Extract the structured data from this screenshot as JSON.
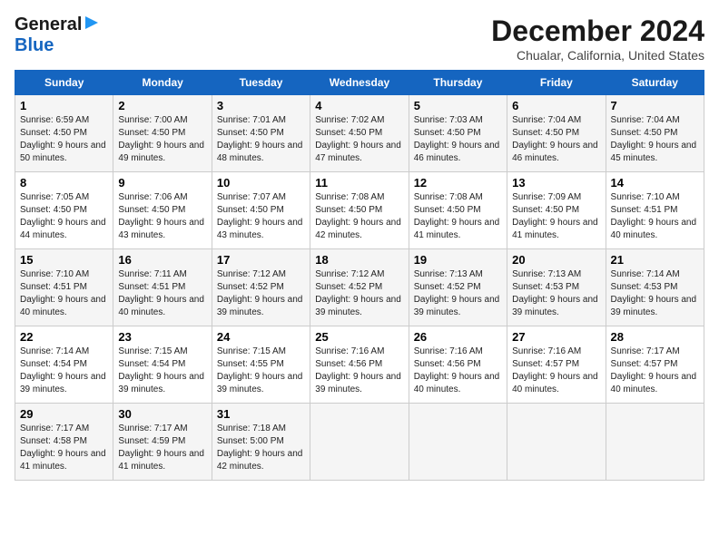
{
  "logo": {
    "line1": "General",
    "line2": "Blue"
  },
  "title": "December 2024",
  "subtitle": "Chualar, California, United States",
  "days_of_week": [
    "Sunday",
    "Monday",
    "Tuesday",
    "Wednesday",
    "Thursday",
    "Friday",
    "Saturday"
  ],
  "weeks": [
    [
      {
        "day": "1",
        "sunrise": "Sunrise: 6:59 AM",
        "sunset": "Sunset: 4:50 PM",
        "daylight": "Daylight: 9 hours and 50 minutes."
      },
      {
        "day": "2",
        "sunrise": "Sunrise: 7:00 AM",
        "sunset": "Sunset: 4:50 PM",
        "daylight": "Daylight: 9 hours and 49 minutes."
      },
      {
        "day": "3",
        "sunrise": "Sunrise: 7:01 AM",
        "sunset": "Sunset: 4:50 PM",
        "daylight": "Daylight: 9 hours and 48 minutes."
      },
      {
        "day": "4",
        "sunrise": "Sunrise: 7:02 AM",
        "sunset": "Sunset: 4:50 PM",
        "daylight": "Daylight: 9 hours and 47 minutes."
      },
      {
        "day": "5",
        "sunrise": "Sunrise: 7:03 AM",
        "sunset": "Sunset: 4:50 PM",
        "daylight": "Daylight: 9 hours and 46 minutes."
      },
      {
        "day": "6",
        "sunrise": "Sunrise: 7:04 AM",
        "sunset": "Sunset: 4:50 PM",
        "daylight": "Daylight: 9 hours and 46 minutes."
      },
      {
        "day": "7",
        "sunrise": "Sunrise: 7:04 AM",
        "sunset": "Sunset: 4:50 PM",
        "daylight": "Daylight: 9 hours and 45 minutes."
      }
    ],
    [
      {
        "day": "8",
        "sunrise": "Sunrise: 7:05 AM",
        "sunset": "Sunset: 4:50 PM",
        "daylight": "Daylight: 9 hours and 44 minutes."
      },
      {
        "day": "9",
        "sunrise": "Sunrise: 7:06 AM",
        "sunset": "Sunset: 4:50 PM",
        "daylight": "Daylight: 9 hours and 43 minutes."
      },
      {
        "day": "10",
        "sunrise": "Sunrise: 7:07 AM",
        "sunset": "Sunset: 4:50 PM",
        "daylight": "Daylight: 9 hours and 43 minutes."
      },
      {
        "day": "11",
        "sunrise": "Sunrise: 7:08 AM",
        "sunset": "Sunset: 4:50 PM",
        "daylight": "Daylight: 9 hours and 42 minutes."
      },
      {
        "day": "12",
        "sunrise": "Sunrise: 7:08 AM",
        "sunset": "Sunset: 4:50 PM",
        "daylight": "Daylight: 9 hours and 41 minutes."
      },
      {
        "day": "13",
        "sunrise": "Sunrise: 7:09 AM",
        "sunset": "Sunset: 4:50 PM",
        "daylight": "Daylight: 9 hours and 41 minutes."
      },
      {
        "day": "14",
        "sunrise": "Sunrise: 7:10 AM",
        "sunset": "Sunset: 4:51 PM",
        "daylight": "Daylight: 9 hours and 40 minutes."
      }
    ],
    [
      {
        "day": "15",
        "sunrise": "Sunrise: 7:10 AM",
        "sunset": "Sunset: 4:51 PM",
        "daylight": "Daylight: 9 hours and 40 minutes."
      },
      {
        "day": "16",
        "sunrise": "Sunrise: 7:11 AM",
        "sunset": "Sunset: 4:51 PM",
        "daylight": "Daylight: 9 hours and 40 minutes."
      },
      {
        "day": "17",
        "sunrise": "Sunrise: 7:12 AM",
        "sunset": "Sunset: 4:52 PM",
        "daylight": "Daylight: 9 hours and 39 minutes."
      },
      {
        "day": "18",
        "sunrise": "Sunrise: 7:12 AM",
        "sunset": "Sunset: 4:52 PM",
        "daylight": "Daylight: 9 hours and 39 minutes."
      },
      {
        "day": "19",
        "sunrise": "Sunrise: 7:13 AM",
        "sunset": "Sunset: 4:52 PM",
        "daylight": "Daylight: 9 hours and 39 minutes."
      },
      {
        "day": "20",
        "sunrise": "Sunrise: 7:13 AM",
        "sunset": "Sunset: 4:53 PM",
        "daylight": "Daylight: 9 hours and 39 minutes."
      },
      {
        "day": "21",
        "sunrise": "Sunrise: 7:14 AM",
        "sunset": "Sunset: 4:53 PM",
        "daylight": "Daylight: 9 hours and 39 minutes."
      }
    ],
    [
      {
        "day": "22",
        "sunrise": "Sunrise: 7:14 AM",
        "sunset": "Sunset: 4:54 PM",
        "daylight": "Daylight: 9 hours and 39 minutes."
      },
      {
        "day": "23",
        "sunrise": "Sunrise: 7:15 AM",
        "sunset": "Sunset: 4:54 PM",
        "daylight": "Daylight: 9 hours and 39 minutes."
      },
      {
        "day": "24",
        "sunrise": "Sunrise: 7:15 AM",
        "sunset": "Sunset: 4:55 PM",
        "daylight": "Daylight: 9 hours and 39 minutes."
      },
      {
        "day": "25",
        "sunrise": "Sunrise: 7:16 AM",
        "sunset": "Sunset: 4:56 PM",
        "daylight": "Daylight: 9 hours and 39 minutes."
      },
      {
        "day": "26",
        "sunrise": "Sunrise: 7:16 AM",
        "sunset": "Sunset: 4:56 PM",
        "daylight": "Daylight: 9 hours and 40 minutes."
      },
      {
        "day": "27",
        "sunrise": "Sunrise: 7:16 AM",
        "sunset": "Sunset: 4:57 PM",
        "daylight": "Daylight: 9 hours and 40 minutes."
      },
      {
        "day": "28",
        "sunrise": "Sunrise: 7:17 AM",
        "sunset": "Sunset: 4:57 PM",
        "daylight": "Daylight: 9 hours and 40 minutes."
      }
    ],
    [
      {
        "day": "29",
        "sunrise": "Sunrise: 7:17 AM",
        "sunset": "Sunset: 4:58 PM",
        "daylight": "Daylight: 9 hours and 41 minutes."
      },
      {
        "day": "30",
        "sunrise": "Sunrise: 7:17 AM",
        "sunset": "Sunset: 4:59 PM",
        "daylight": "Daylight: 9 hours and 41 minutes."
      },
      {
        "day": "31",
        "sunrise": "Sunrise: 7:18 AM",
        "sunset": "Sunset: 5:00 PM",
        "daylight": "Daylight: 9 hours and 42 minutes."
      },
      null,
      null,
      null,
      null
    ]
  ]
}
